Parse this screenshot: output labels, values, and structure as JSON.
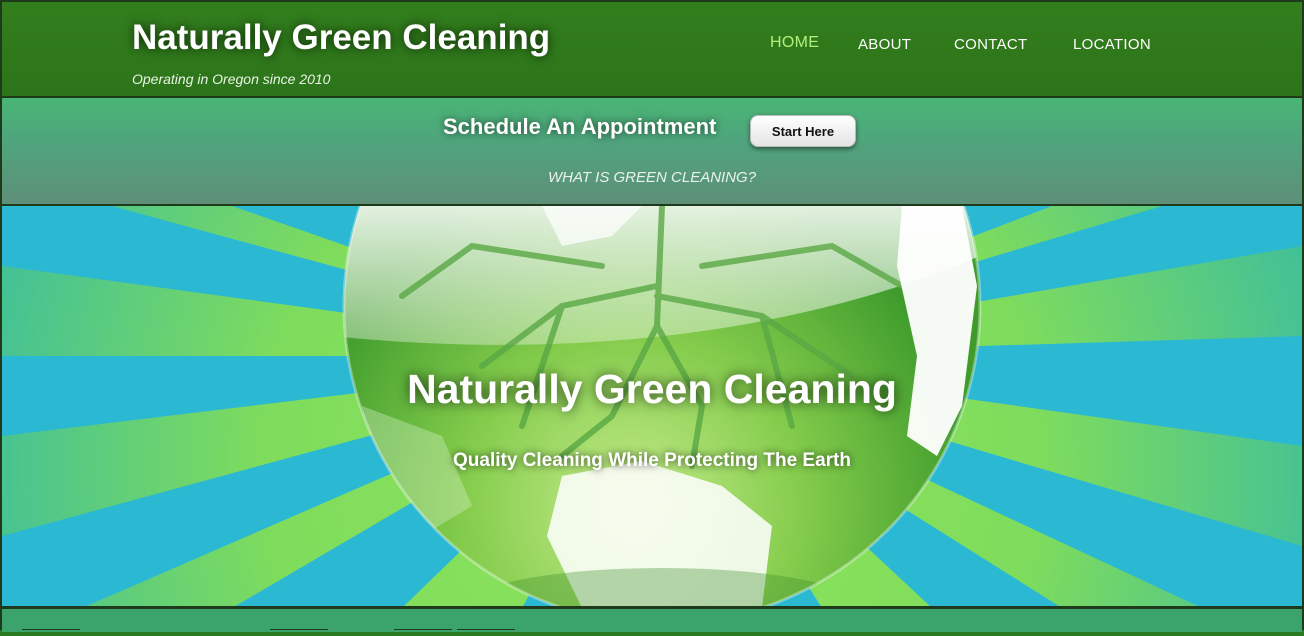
{
  "header": {
    "title": "Naturally Green Cleaning",
    "tagline": "Operating in Oregon since 2010"
  },
  "nav": {
    "items": [
      {
        "label": "HOME",
        "active": true
      },
      {
        "label": "ABOUT",
        "active": false
      },
      {
        "label": "CONTACT",
        "active": false
      },
      {
        "label": "LOCATION",
        "active": false
      }
    ]
  },
  "appointment": {
    "heading": "Schedule An Appointment",
    "button_label": "Start Here",
    "link_text": "WHAT IS GREEN CLEANING?"
  },
  "hero": {
    "title": "Naturally Green Cleaning",
    "subtitle": "Quality Cleaning While Protecting The Earth",
    "image": "green-globe-with-roots"
  },
  "colors": {
    "header_green": "#2f7a1c",
    "band_green": "#49b574",
    "nav_active": "#b2ef7c",
    "sky_blue": "#2bb8d2"
  }
}
